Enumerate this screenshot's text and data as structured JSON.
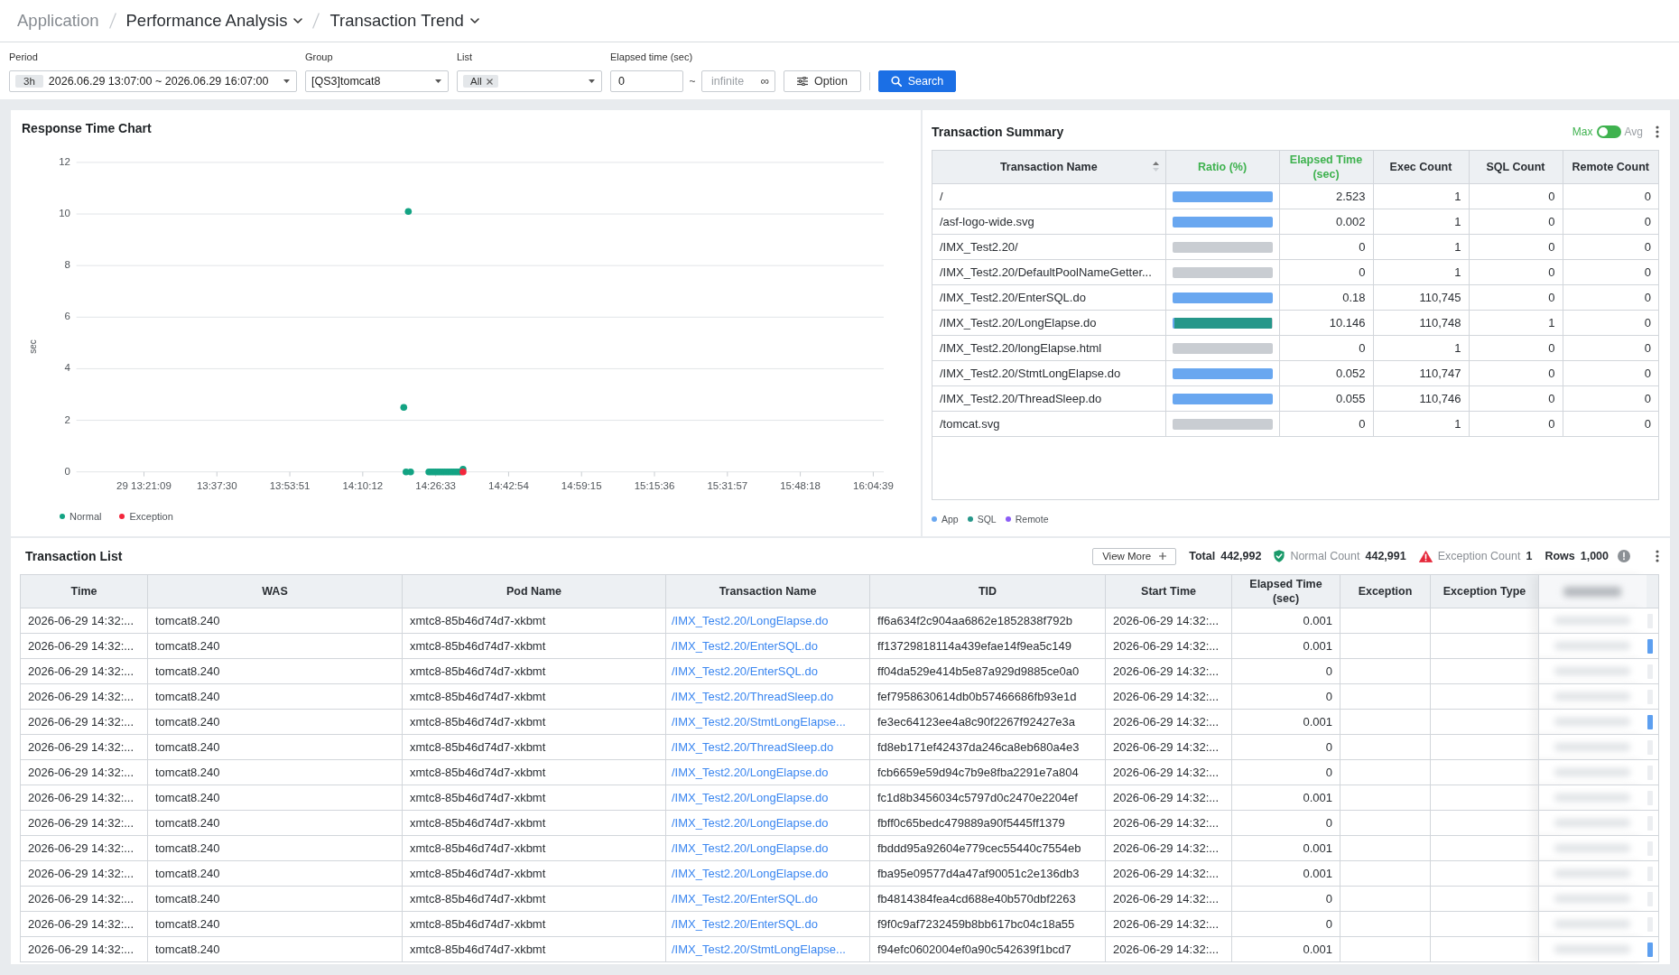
{
  "breadcrumb": [
    {
      "label": "Application",
      "kind": "root"
    },
    {
      "label": "Performance Analysis",
      "kind": "menu"
    },
    {
      "label": "Transaction Trend",
      "kind": "menu"
    }
  ],
  "filters": {
    "period": {
      "label": "Period",
      "chip": "3h",
      "value": "2026.06.29 13:07:00 ~ 2026.06.29 16:07:00"
    },
    "group": {
      "label": "Group",
      "value": "[QS3]tomcat8"
    },
    "list": {
      "label": "List",
      "chip": "All"
    },
    "elapsed_time": {
      "label": "Elapsed time (sec)",
      "min": {
        "value": "0"
      },
      "separator": "~",
      "max": {
        "placeholder": "infinite",
        "suffix": "∞"
      }
    },
    "option_button": {
      "label": "Option"
    },
    "search_button": {
      "label": "Search"
    }
  },
  "chart": {
    "chart_data": {
      "type": "scatter",
      "title": "Response Time Chart",
      "ylabel": "sec",
      "grid": true,
      "ylim": [
        0,
        12
      ],
      "yticks": [
        0,
        2,
        4,
        6,
        8,
        10,
        12
      ],
      "categories": [
        null,
        null,
        null,
        null,
        null,
        null,
        null,
        null,
        null,
        null,
        null,
        null,
        null,
        null,
        null,
        null,
        null,
        null,
        null,
        null,
        null,
        null,
        null,
        null,
        null,
        null,
        null,
        null,
        null,
        "29 13:21:09",
        null,
        null,
        null,
        null,
        null,
        null,
        null,
        null,
        null,
        null,
        null,
        null,
        null,
        null,
        null,
        null,
        null,
        null,
        null,
        null,
        null,
        null,
        null,
        null,
        null,
        null,
        null,
        null,
        null,
        null,
        null,
        "13:37:30",
        null,
        null,
        null,
        null,
        null,
        null,
        null,
        null,
        null,
        null,
        null,
        null,
        null,
        null,
        null,
        null,
        null,
        null,
        null,
        null,
        null,
        null,
        null,
        null,
        null,
        null,
        null,
        null,
        null,
        null,
        null,
        "13:53:51",
        null,
        null,
        null,
        null,
        null,
        null,
        null,
        null,
        null,
        null,
        null,
        null,
        null,
        null,
        null,
        null,
        null,
        null,
        null,
        null,
        null,
        null,
        null,
        null,
        null,
        null,
        null,
        null,
        null,
        null,
        null,
        "14:10:12",
        null,
        null,
        null,
        null,
        null,
        null,
        null,
        null,
        null,
        null,
        null,
        null,
        null,
        null,
        null,
        null,
        null,
        null,
        null,
        null,
        null,
        null,
        null,
        null,
        null,
        null,
        null,
        null,
        null,
        null,
        null,
        "14:26:33",
        null,
        null,
        null,
        null,
        null,
        null,
        null,
        null,
        null,
        null,
        null,
        null,
        null,
        null,
        null,
        null,
        null,
        null,
        null,
        null,
        null,
        null,
        null,
        null,
        null,
        null,
        null,
        null,
        null,
        null,
        null,
        "14:42:54",
        null,
        null,
        null,
        null,
        null,
        null,
        null,
        null,
        null,
        null,
        null,
        null,
        null,
        null,
        null,
        null,
        null,
        null,
        null,
        null,
        null,
        null,
        null,
        null,
        null,
        null,
        null,
        null,
        null,
        null,
        null,
        "14:59:15",
        null,
        null,
        null,
        null,
        null,
        null,
        null,
        null,
        null,
        null,
        null,
        null,
        null,
        null,
        null,
        null,
        null,
        null,
        null,
        null,
        null,
        null,
        null,
        null,
        null,
        null,
        null,
        null,
        null,
        null,
        null,
        "15:15:36",
        null,
        null,
        null,
        null,
        null,
        null,
        null,
        null,
        null,
        null,
        null,
        null,
        null,
        null,
        null,
        null,
        null,
        null,
        null,
        null,
        null,
        null,
        null,
        null,
        null,
        null,
        null,
        null,
        null,
        null,
        null,
        "15:31:57",
        null,
        null,
        null,
        null,
        null,
        null,
        null,
        null,
        null,
        null,
        null,
        null,
        null,
        null,
        null,
        null,
        null,
        null,
        null,
        null,
        null,
        null,
        null,
        null,
        null,
        null,
        null,
        null,
        null,
        null,
        null,
        "15:48:18",
        null,
        null,
        null,
        null,
        null,
        null,
        null,
        null,
        null,
        null,
        null,
        null,
        null,
        null,
        null,
        null,
        null,
        null,
        null,
        null,
        null,
        null,
        null,
        null,
        null,
        null,
        null,
        null,
        null,
        null,
        null,
        "16:04:39",
        null,
        null,
        null,
        null
      ],
      "series": [
        {
          "name": "Normal",
          "color": "#13a383",
          "values": [
            null,
            null,
            null,
            null,
            null,
            null,
            null,
            null,
            null,
            null,
            null,
            null,
            null,
            null,
            null,
            null,
            null,
            null,
            null,
            null,
            null,
            null,
            null,
            null,
            null,
            null,
            null,
            null,
            null,
            null,
            null,
            null,
            null,
            null,
            null,
            null,
            null,
            null,
            null,
            null,
            null,
            null,
            null,
            null,
            null,
            null,
            null,
            null,
            null,
            null,
            null,
            null,
            null,
            null,
            null,
            null,
            null,
            null,
            null,
            null,
            null,
            null,
            null,
            null,
            null,
            null,
            null,
            null,
            null,
            null,
            null,
            null,
            null,
            null,
            null,
            null,
            null,
            null,
            null,
            null,
            null,
            null,
            null,
            null,
            null,
            null,
            null,
            null,
            null,
            null,
            null,
            null,
            null,
            null,
            null,
            null,
            null,
            null,
            null,
            null,
            null,
            null,
            null,
            null,
            null,
            null,
            null,
            null,
            null,
            null,
            null,
            null,
            null,
            null,
            null,
            null,
            null,
            null,
            null,
            null,
            null,
            null,
            null,
            null,
            null,
            null,
            null,
            null,
            null,
            null,
            null,
            null,
            null,
            null,
            null,
            null,
            null,
            null,
            null,
            null,
            null,
            null,
            null,
            2.5,
            0,
            10.1,
            0,
            null,
            null,
            null,
            null,
            null,
            null,
            null,
            0,
            0,
            0,
            0,
            0,
            0,
            0,
            0,
            0,
            0,
            0,
            0,
            0,
            0,
            0,
            0.1,
            null,
            null,
            null,
            null,
            null,
            null,
            null,
            null,
            null,
            null,
            null,
            null,
            null,
            null,
            null,
            null,
            null,
            null,
            null,
            null,
            null,
            null,
            null,
            null,
            null,
            null,
            null,
            null,
            null,
            null,
            null,
            null,
            null,
            null,
            null,
            null,
            null,
            null,
            null,
            null,
            null,
            null,
            null,
            null,
            null,
            null,
            null,
            null,
            null,
            null,
            null,
            null,
            null,
            null,
            null,
            null,
            null,
            null,
            null,
            null,
            null,
            null,
            null,
            null,
            null,
            null,
            null,
            null,
            null,
            null,
            null,
            null,
            null,
            null,
            null,
            null,
            null,
            null,
            null,
            null,
            null,
            null,
            null,
            null,
            null,
            null,
            null,
            null,
            null,
            null,
            null,
            null,
            null,
            null,
            null,
            null,
            null,
            null,
            null,
            null,
            null,
            null,
            null,
            null,
            null,
            null,
            null,
            null,
            null,
            null,
            null,
            null,
            null,
            null,
            null,
            null,
            null,
            null,
            null,
            null,
            null,
            null,
            null,
            null,
            null,
            null,
            null,
            null,
            null,
            null,
            null,
            null,
            null,
            null,
            null,
            null,
            null,
            null,
            null,
            null,
            null,
            null,
            null,
            null,
            null,
            null,
            null,
            null,
            null,
            null,
            null,
            null,
            null,
            null,
            null,
            null,
            null,
            null,
            null,
            null,
            null,
            null,
            null,
            null,
            null,
            null,
            null,
            null,
            null,
            null,
            null,
            null,
            null,
            null,
            null,
            null,
            null,
            null,
            null,
            null,
            null,
            null,
            null,
            null
          ]
        },
        {
          "name": "Exception",
          "color": "#f3263c",
          "values": [
            null,
            null,
            null,
            null,
            null,
            null,
            null,
            null,
            null,
            null,
            null,
            null,
            null,
            null,
            null,
            null,
            null,
            null,
            null,
            null,
            null,
            null,
            null,
            null,
            null,
            null,
            null,
            null,
            null,
            null,
            null,
            null,
            null,
            null,
            null,
            null,
            null,
            null,
            null,
            null,
            null,
            null,
            null,
            null,
            null,
            null,
            null,
            null,
            null,
            null,
            null,
            null,
            null,
            null,
            null,
            null,
            null,
            null,
            null,
            null,
            null,
            null,
            null,
            null,
            null,
            null,
            null,
            null,
            null,
            null,
            null,
            null,
            null,
            null,
            null,
            null,
            null,
            null,
            null,
            null,
            null,
            null,
            null,
            null,
            null,
            null,
            null,
            null,
            null,
            null,
            null,
            null,
            null,
            null,
            null,
            null,
            null,
            null,
            null,
            null,
            null,
            null,
            null,
            null,
            null,
            null,
            null,
            null,
            null,
            null,
            null,
            null,
            null,
            null,
            null,
            null,
            null,
            null,
            null,
            null,
            null,
            null,
            null,
            null,
            null,
            null,
            null,
            null,
            null,
            null,
            null,
            null,
            null,
            null,
            null,
            null,
            null,
            null,
            null,
            null,
            null,
            null,
            null,
            null,
            null,
            null,
            null,
            null,
            null,
            null,
            null,
            null,
            null,
            null,
            null,
            null,
            null,
            null,
            null,
            null,
            null,
            null,
            null,
            null,
            null,
            null,
            null,
            null,
            null,
            0,
            null,
            null,
            null,
            null,
            null,
            null,
            null,
            null,
            null,
            null,
            null,
            null,
            null,
            null,
            null,
            null,
            null,
            null,
            null,
            null,
            null,
            null,
            null,
            null,
            null,
            null,
            null,
            null,
            null,
            null,
            null,
            null,
            null,
            null,
            null,
            null,
            null,
            null,
            null,
            null,
            null,
            null,
            null,
            null,
            null,
            null,
            null,
            null,
            null,
            null,
            null,
            null,
            null,
            null,
            null,
            null,
            null,
            null,
            null,
            null,
            null,
            null,
            null,
            null,
            null,
            null,
            null,
            null,
            null,
            null,
            null,
            null,
            null,
            null,
            null,
            null,
            null,
            null,
            null,
            null,
            null,
            null,
            null,
            null,
            null,
            null,
            null,
            null,
            null,
            null,
            null,
            null,
            null,
            null,
            null,
            null,
            null,
            null,
            null,
            null,
            null,
            null,
            null,
            null,
            null,
            null,
            null,
            null,
            null,
            null,
            null,
            null,
            null,
            null,
            null,
            null,
            null,
            null,
            null,
            null,
            null,
            null,
            null,
            null,
            null,
            null,
            null,
            null,
            null,
            null,
            null,
            null,
            null,
            null,
            null,
            null,
            null,
            null,
            null,
            null,
            null,
            null,
            null,
            null,
            null,
            null,
            null,
            null,
            null,
            null,
            null,
            null,
            null,
            null,
            null,
            null,
            null,
            null,
            null,
            null,
            null,
            null,
            null,
            null,
            null,
            null,
            null,
            null,
            null,
            null,
            null,
            null,
            null,
            null,
            null,
            null,
            null,
            null,
            null,
            null,
            null,
            null,
            null,
            null
          ]
        }
      ]
    }
  },
  "summary": {
    "title": "Transaction Summary",
    "mode_toggle": [
      {
        "label": "Max",
        "selected": true
      },
      {
        "label": "Avg",
        "selected": false
      }
    ],
    "columns": [
      {
        "label": "Transaction Name",
        "kind": "name",
        "sortable": true,
        "highlighted": false
      },
      {
        "label": "Ratio (%)",
        "kind": "ratio",
        "sortable": false,
        "highlighted": true
      },
      {
        "label": "Elapsed Time (sec)",
        "kind": "number",
        "sortable": false,
        "highlighted": true
      },
      {
        "label": "Exec Count",
        "kind": "number",
        "sortable": false,
        "highlighted": false
      },
      {
        "label": "SQL Count",
        "kind": "number",
        "sortable": false,
        "highlighted": false
      },
      {
        "label": "Remote Count",
        "kind": "number",
        "sortable": false,
        "highlighted": false
      }
    ],
    "rows": [
      {
        "name": "/",
        "ratio": [
          {
            "kind": "app",
            "level": 1
          }
        ],
        "values": [
          "2.523",
          "1",
          "0",
          "0"
        ]
      },
      {
        "name": "/asf-logo-wide.svg",
        "ratio": [
          {
            "kind": "app",
            "level": 1
          }
        ],
        "values": [
          "0.002",
          "1",
          "0",
          "0"
        ]
      },
      {
        "name": "/IMX_Test2.20/",
        "values": [
          "0",
          "1",
          "0",
          "0"
        ]
      },
      {
        "name": "/IMX_Test2.20/DefaultPoolNameGetter...",
        "values": [
          "0",
          "1",
          "0",
          "0"
        ]
      },
      {
        "name": "/IMX_Test2.20/EnterSQL.do",
        "ratio": [
          {
            "kind": "app",
            "level": 1
          }
        ],
        "values": [
          "0.18",
          "110,745",
          "0",
          "0"
        ]
      },
      {
        "name": "/IMX_Test2.20/LongElapse.do",
        "ratio": [
          {
            "kind": "app",
            "level": 0.02
          },
          {
            "kind": "sql",
            "level": 0.98
          }
        ],
        "values": [
          "10.146",
          "110,748",
          "1",
          "0"
        ]
      },
      {
        "name": "/IMX_Test2.20/longElapse.html",
        "values": [
          "0",
          "1",
          "0",
          "0"
        ]
      },
      {
        "name": "/IMX_Test2.20/StmtLongElapse.do",
        "ratio": [
          {
            "kind": "app",
            "level": 1
          }
        ],
        "values": [
          "0.052",
          "110,747",
          "0",
          "0"
        ]
      },
      {
        "name": "/IMX_Test2.20/ThreadSleep.do",
        "ratio": [
          {
            "kind": "app",
            "level": 1
          }
        ],
        "values": [
          "0.055",
          "110,746",
          "0",
          "0"
        ]
      },
      {
        "name": "/tomcat.svg",
        "values": [
          "0",
          "1",
          "0",
          "0"
        ]
      }
    ],
    "legend": [
      {
        "kind": "app",
        "label": "App",
        "color": "#69a7f0"
      },
      {
        "kind": "sql",
        "label": "SQL",
        "color": "#26978a"
      },
      {
        "kind": "remote",
        "label": "Remote",
        "color": "#8b5cf6"
      }
    ]
  },
  "transaction_list": {
    "title": "Transaction List",
    "view_more_button": {
      "label": "View More"
    },
    "stats": [
      {
        "kind": "total",
        "label": "Total",
        "value": "442,992"
      },
      {
        "kind": "normal",
        "label": "Normal Count",
        "value": "442,991"
      },
      {
        "kind": "exception",
        "label": "Exception Count",
        "value": "1"
      },
      {
        "kind": "rows",
        "label": "Rows",
        "value": "1,000"
      }
    ],
    "columns": [
      {
        "label": "Time",
        "kind": "text"
      },
      {
        "label": "WAS",
        "kind": "text"
      },
      {
        "label": "Pod Name",
        "kind": "text"
      },
      {
        "label": "Transaction Name",
        "kind": "link"
      },
      {
        "label": "TID",
        "kind": "text"
      },
      {
        "label": "Start Time",
        "kind": "text"
      },
      {
        "label": "Elapsed Time (sec)",
        "kind": "number"
      },
      {
        "label": "Exception",
        "kind": "text"
      },
      {
        "label": "Exception Type",
        "kind": "text"
      }
    ],
    "rows": [
      {
        "cells": [
          "2026-06-29 14:32:...",
          "tomcat8.240",
          "xmtc8-85b46d74d7-xkbmt",
          "/IMX_Test2.20/LongElapse.do",
          "ff6a634f2c904aa6862e1852838f792b",
          "2026-06-29 14:32:...",
          "0.001"
        ],
        "cut_bar_filled": false
      },
      {
        "cells": [
          "2026-06-29 14:32:...",
          "tomcat8.240",
          "xmtc8-85b46d74d7-xkbmt",
          "/IMX_Test2.20/EnterSQL.do",
          "ff13729818114a439efae14f9ea5c149",
          "2026-06-29 14:32:...",
          "0.001"
        ],
        "cut_bar_filled": true
      },
      {
        "cells": [
          "2026-06-29 14:32:...",
          "tomcat8.240",
          "xmtc8-85b46d74d7-xkbmt",
          "/IMX_Test2.20/EnterSQL.do",
          "ff04da529e414b5e87a929d9885ce0a0",
          "2026-06-29 14:32:...",
          "0"
        ],
        "cut_bar_filled": false
      },
      {
        "cells": [
          "2026-06-29 14:32:...",
          "tomcat8.240",
          "xmtc8-85b46d74d7-xkbmt",
          "/IMX_Test2.20/ThreadSleep.do",
          "fef7958630614db0b57466686fb93e1d",
          "2026-06-29 14:32:...",
          "0"
        ],
        "cut_bar_filled": false
      },
      {
        "cells": [
          "2026-06-29 14:32:...",
          "tomcat8.240",
          "xmtc8-85b46d74d7-xkbmt",
          "/IMX_Test2.20/StmtLongElapse...",
          "fe3ec64123ee4a8c90f2267f92427e3a",
          "2026-06-29 14:32:...",
          "0.001"
        ],
        "cut_bar_filled": true
      },
      {
        "cells": [
          "2026-06-29 14:32:...",
          "tomcat8.240",
          "xmtc8-85b46d74d7-xkbmt",
          "/IMX_Test2.20/ThreadSleep.do",
          "fd8eb171ef42437da246ca8eb680a4e3",
          "2026-06-29 14:32:...",
          "0"
        ],
        "cut_bar_filled": false
      },
      {
        "cells": [
          "2026-06-29 14:32:...",
          "tomcat8.240",
          "xmtc8-85b46d74d7-xkbmt",
          "/IMX_Test2.20/LongElapse.do",
          "fcb6659e59d94c7b9e8fba2291e7a804",
          "2026-06-29 14:32:...",
          "0"
        ],
        "cut_bar_filled": false
      },
      {
        "cells": [
          "2026-06-29 14:32:...",
          "tomcat8.240",
          "xmtc8-85b46d74d7-xkbmt",
          "/IMX_Test2.20/LongElapse.do",
          "fc1d8b3456034c5797d0c2470e2204ef",
          "2026-06-29 14:32:...",
          "0.001"
        ],
        "cut_bar_filled": false
      },
      {
        "cells": [
          "2026-06-29 14:32:...",
          "tomcat8.240",
          "xmtc8-85b46d74d7-xkbmt",
          "/IMX_Test2.20/LongElapse.do",
          "fbff0c65bedc479889a90f5445ff1379",
          "2026-06-29 14:32:...",
          "0"
        ],
        "cut_bar_filled": false
      },
      {
        "cells": [
          "2026-06-29 14:32:...",
          "tomcat8.240",
          "xmtc8-85b46d74d7-xkbmt",
          "/IMX_Test2.20/LongElapse.do",
          "fbddd95a92604e779cec55440c7554eb",
          "2026-06-29 14:32:...",
          "0.001"
        ],
        "cut_bar_filled": false
      },
      {
        "cells": [
          "2026-06-29 14:32:...",
          "tomcat8.240",
          "xmtc8-85b46d74d7-xkbmt",
          "/IMX_Test2.20/LongElapse.do",
          "fba95e09577d4a47af90051c2e136db3",
          "2026-06-29 14:32:...",
          "0.001"
        ],
        "cut_bar_filled": false
      },
      {
        "cells": [
          "2026-06-29 14:32:...",
          "tomcat8.240",
          "xmtc8-85b46d74d7-xkbmt",
          "/IMX_Test2.20/EnterSQL.do",
          "fb4814384fea4cd688e40b570dbf2263",
          "2026-06-29 14:32:...",
          "0"
        ],
        "cut_bar_filled": false
      },
      {
        "cells": [
          "2026-06-29 14:32:...",
          "tomcat8.240",
          "xmtc8-85b46d74d7-xkbmt",
          "/IMX_Test2.20/EnterSQL.do",
          "f9f0c9af7232459b8bb617bc04c18a55",
          "2026-06-29 14:32:...",
          "0"
        ],
        "cut_bar_filled": false
      },
      {
        "cells": [
          "2026-06-29 14:32:...",
          "tomcat8.240",
          "xmtc8-85b46d74d7-xkbmt",
          "/IMX_Test2.20/StmtLongElapse...",
          "f94efc0602004ef0a90c542639f1bcd7",
          "2026-06-29 14:32:...",
          "0.001"
        ],
        "cut_bar_filled": true
      }
    ]
  }
}
